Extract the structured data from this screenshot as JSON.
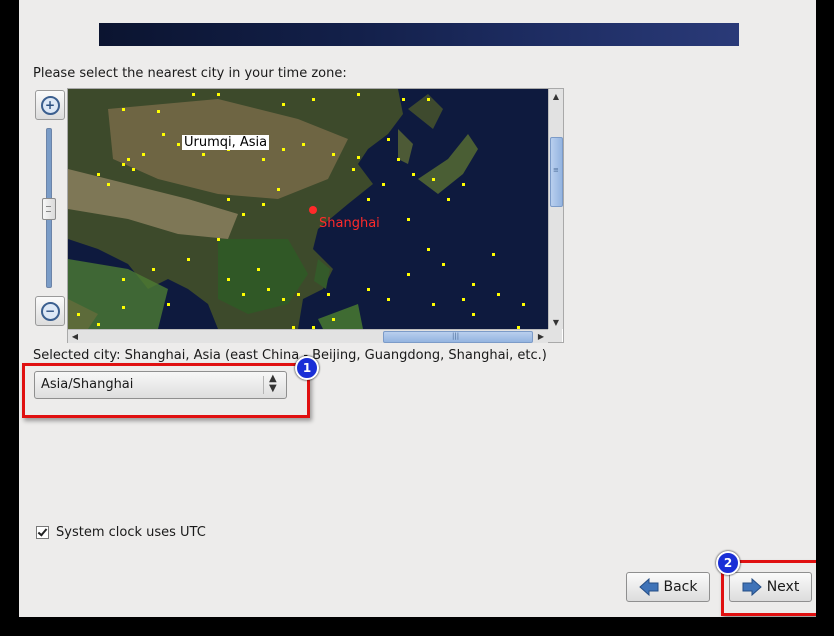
{
  "timezone": {
    "prompt": "Please select the nearest city in your time zone:",
    "selected_city_text": "Selected city: Shanghai, Asia (east China - Beijing, Guangdong, Shanghai, etc.)",
    "select_value": "Asia/Shanghai"
  },
  "map": {
    "hover_label": "Urumqi, Asia",
    "selected_label": "Shanghai",
    "selected_color": "#ff2a2a",
    "city_dot_color": "#ffff00"
  },
  "zoom": {
    "in_icon": "zoom-in-icon",
    "out_icon": "zoom-out-icon"
  },
  "options": {
    "utc_label": "System clock uses UTC",
    "utc_checked": true
  },
  "buttons": {
    "back_label": "Back",
    "next_label": "Next"
  },
  "annotations": {
    "marker1": "1",
    "marker2": "2",
    "highlight_color": "#e01010",
    "marker_color": "#1a2fd6"
  },
  "banner": {
    "color": "#13204a"
  }
}
